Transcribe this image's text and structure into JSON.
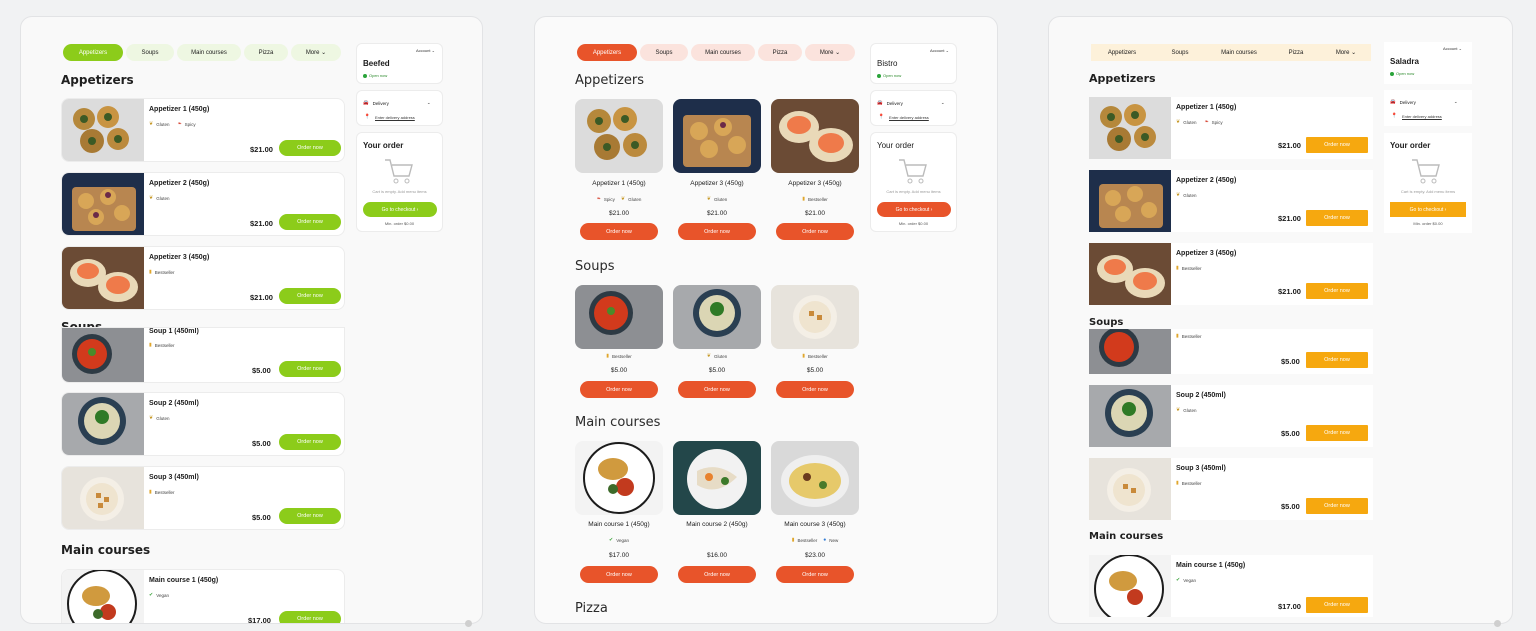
{
  "colors": {
    "green": "#8ccc1a",
    "green_light": "#eef7e2",
    "orange": "#e8542a",
    "orange_light": "#fbe3dd",
    "amber": "#f6a80f",
    "amber_light": "#fdf1da"
  },
  "tabs": [
    "Appetizers",
    "Soups",
    "Main courses",
    "Pizza",
    "More ⌄"
  ],
  "sections": {
    "appetizers": "Appetizers",
    "soups": "Soups",
    "main": "Main courses",
    "pizza": "Pizza"
  },
  "common": {
    "order_now": "Order now",
    "account": "Account ⌄",
    "open_now": "Open now",
    "delivery": "Delivery",
    "enter_address": "Enter delivery address",
    "your_order": "Your order",
    "cart_empty": "Cart is empty. Add menu items",
    "checkout": "Go to checkout ›",
    "min_order": "Min. order $0.00"
  },
  "tag_labels": {
    "gluten": "Gluten",
    "spicy": "Spicy",
    "bestseller": "Bestseller",
    "vegan": "Vegan",
    "new": "New"
  },
  "restaurants": {
    "p1": "Beefed",
    "p2": "Bistro",
    "p3": "Saladra"
  },
  "items": {
    "a1": {
      "name": "Appetizer 1 (450g)",
      "price": "$21.00"
    },
    "a2": {
      "name": "Appetizer 2 (450g)",
      "price": "$21.00"
    },
    "a3": {
      "name": "Appetizer 3 (450g)",
      "price": "$21.00"
    },
    "s1": {
      "name": "Soup 1 (450ml)",
      "price": "$5.00"
    },
    "s2": {
      "name": "Soup 2 (450ml)",
      "price": "$5.00"
    },
    "s3": {
      "name": "Soup 3 (450ml)",
      "price": "$5.00"
    },
    "m1": {
      "name": "Main course 1 (450g)",
      "price": "$17.00"
    },
    "m2": {
      "name": "Main course 2 (450g)",
      "price": "$16.00"
    },
    "m3": {
      "name": "Main course 3 (450g)",
      "price": "$23.00"
    }
  },
  "p2_titles": {
    "a1": "Appetizer 1 (450g)",
    "a2": "Appetizer 3 (450g)",
    "a3": "Appetizer 3 (450g)"
  }
}
